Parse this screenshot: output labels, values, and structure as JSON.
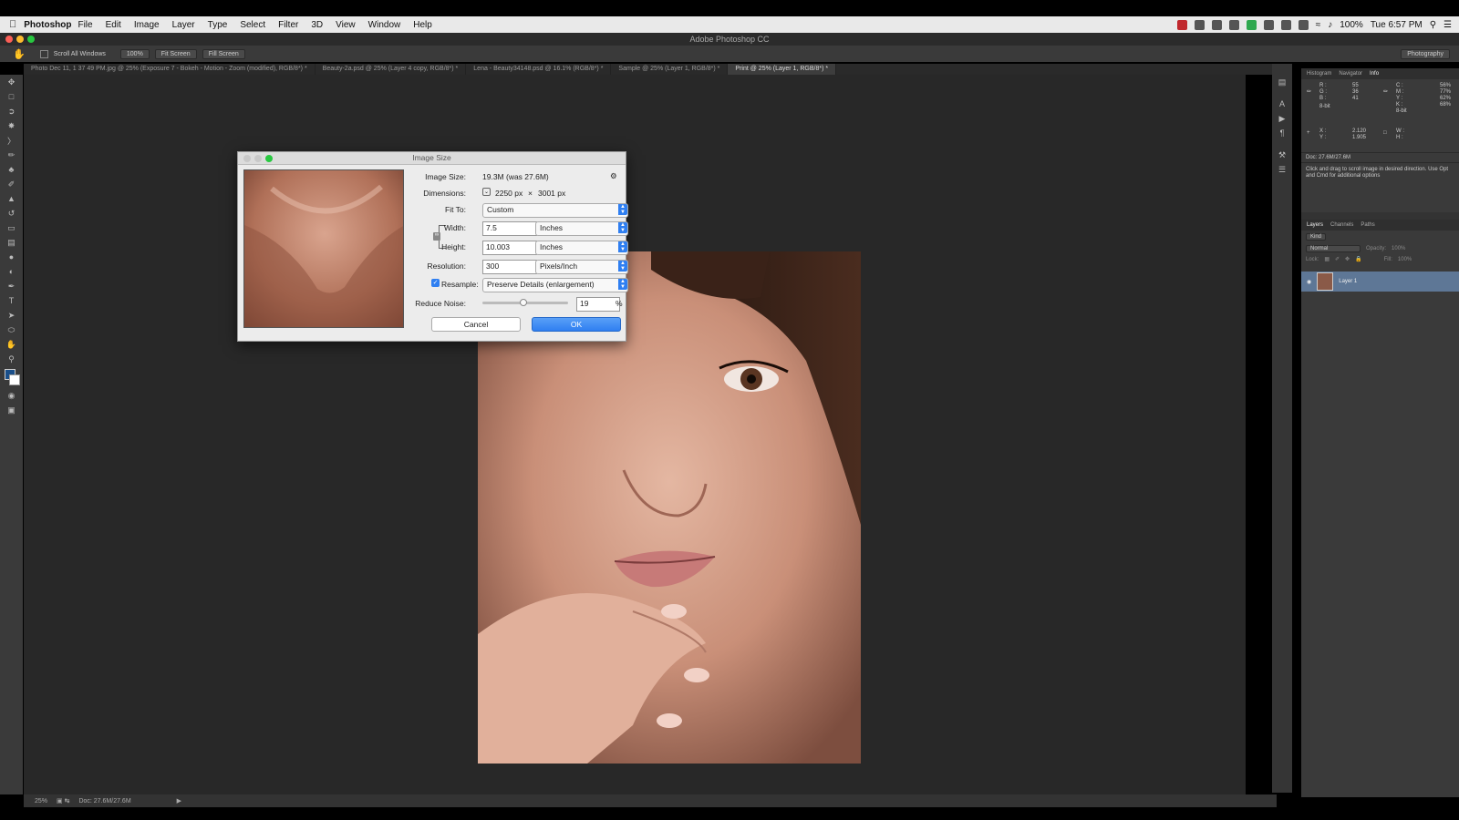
{
  "menubar": {
    "app": "Photoshop",
    "items": [
      "File",
      "Edit",
      "Image",
      "Layer",
      "Type",
      "Select",
      "Filter",
      "3D",
      "View",
      "Window",
      "Help"
    ],
    "battery": "100%",
    "clock": "Tue 6:57 PM"
  },
  "window": {
    "title": "Adobe Photoshop CC"
  },
  "options": {
    "scroll_all": "Scroll All Windows",
    "zoom100": "100%",
    "fit_screen": "Fit Screen",
    "fill_screen": "Fill Screen",
    "workspace": "Photography"
  },
  "tabs": [
    "Photo Dec 11, 1 37 49 PM.jpg @ 25% (Exposure 7 - Bokeh - Motion - Zoom (modified), RGB/8*) *",
    "Beauty-2a.psd @ 25% (Layer 4 copy, RGB/8*) *",
    "Lena - Beauty34148.psd @ 16.1% (RGB/8*) *",
    "Sample @ 25% (Layer 1, RGB/8*) *",
    "Print @ 25% (Layer 1, RGB/8*) *"
  ],
  "info_panel": {
    "tabs": [
      "Histogram",
      "Navigator",
      "Info"
    ],
    "rgb": {
      "r_label": "R :",
      "r": "55",
      "g_label": "G :",
      "g": "36",
      "b_label": "B :",
      "b": "41",
      "bits": "8-bit"
    },
    "cmyk": {
      "c_label": "C :",
      "c": "56%",
      "m_label": "M :",
      "m": "77%",
      "y_label": "Y :",
      "y": "62%",
      "k_label": "K :",
      "k": "68%",
      "bits": "8-bit"
    },
    "xy": {
      "x_label": "X :",
      "x": "2.120",
      "y_label": "Y :",
      "y": "1.905"
    },
    "wh": {
      "w_label": "W :",
      "h_label": "H :"
    },
    "doc": "Doc: 27.6M/27.6M",
    "hint": "Click and drag to scroll image in desired direction. Use Opt and Cmd for additional options"
  },
  "layers_panel": {
    "tabs": [
      "Layers",
      "Channels",
      "Paths"
    ],
    "kind": "Kind",
    "blend": "Normal",
    "opacity_label": "Opacity:",
    "opacity": "100%",
    "lock_label": "Lock:",
    "fill_label": "Fill:",
    "fill": "100%",
    "layer_name": "Layer 1"
  },
  "status": {
    "zoom": "25%",
    "doc": "Doc: 27.6M/27.6M"
  },
  "dialog": {
    "title": "Image Size",
    "image_size_label": "Image Size:",
    "image_size": "19.3M (was 27.6M)",
    "dimensions_label": "Dimensions:",
    "dim_w": "2250 px",
    "dim_x": "×",
    "dim_h": "3001 px",
    "fit_to_label": "Fit To:",
    "fit_to": "Custom",
    "width_label": "Width:",
    "width": "7.5",
    "width_unit": "Inches",
    "height_label": "Height:",
    "height": "10.003",
    "height_unit": "Inches",
    "resolution_label": "Resolution:",
    "resolution": "300",
    "resolution_unit": "Pixels/Inch",
    "resample_label": "Resample:",
    "resample": "Preserve Details (enlargement)",
    "reduce_noise_label": "Reduce Noise:",
    "reduce_noise": "19",
    "reduce_noise_pct": "%",
    "reduce_noise_level": 0.48,
    "cancel": "Cancel",
    "ok": "OK"
  },
  "colors": {
    "accent": "#2f7ff1",
    "canvas": "#282828",
    "panel": "#3a3a3a"
  }
}
